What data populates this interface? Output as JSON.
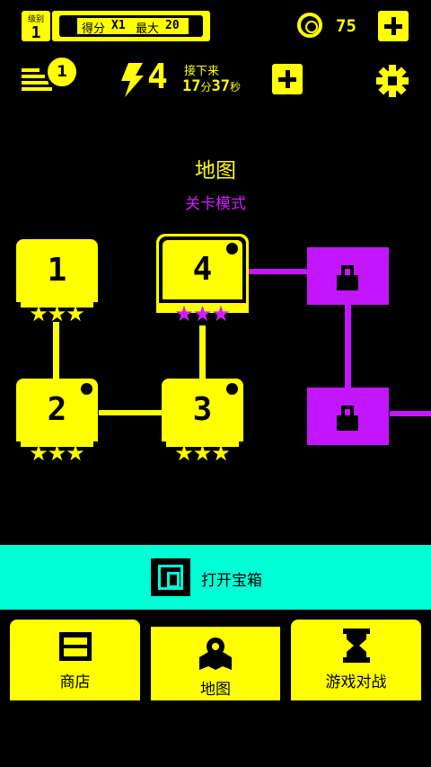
{
  "top": {
    "level_label": "级别",
    "level_value": "1",
    "score_label": "得分",
    "score_multiplier": "X1",
    "max_label": "最大",
    "max_value": "20",
    "coins": "75",
    "badge_count": "1",
    "energy": "4",
    "next_label": "接下来",
    "timer_min": "17",
    "timer_min_unit": "分",
    "timer_sec": "37",
    "timer_sec_unit": "秒"
  },
  "map": {
    "title": "地图",
    "mode": "关卡模式",
    "levels": [
      {
        "number": "1",
        "stars": "★★★",
        "star_color": "#ffff00"
      },
      {
        "number": "2",
        "stars": "★★★",
        "star_color": "#ffff00"
      },
      {
        "number": "3",
        "stars": "★★★",
        "star_color": "#ffff00"
      },
      {
        "number": "4",
        "stars": "★★★",
        "star_color": "#d11dff"
      }
    ]
  },
  "chest": {
    "label": "打开宝箱"
  },
  "nav": {
    "shop": "商店",
    "map": "地图",
    "battle": "游戏对战"
  },
  "colors": {
    "accent": "#ffff00",
    "locked": "#c316ff",
    "chest_bar": "#00ffd6",
    "background": "#000000"
  }
}
